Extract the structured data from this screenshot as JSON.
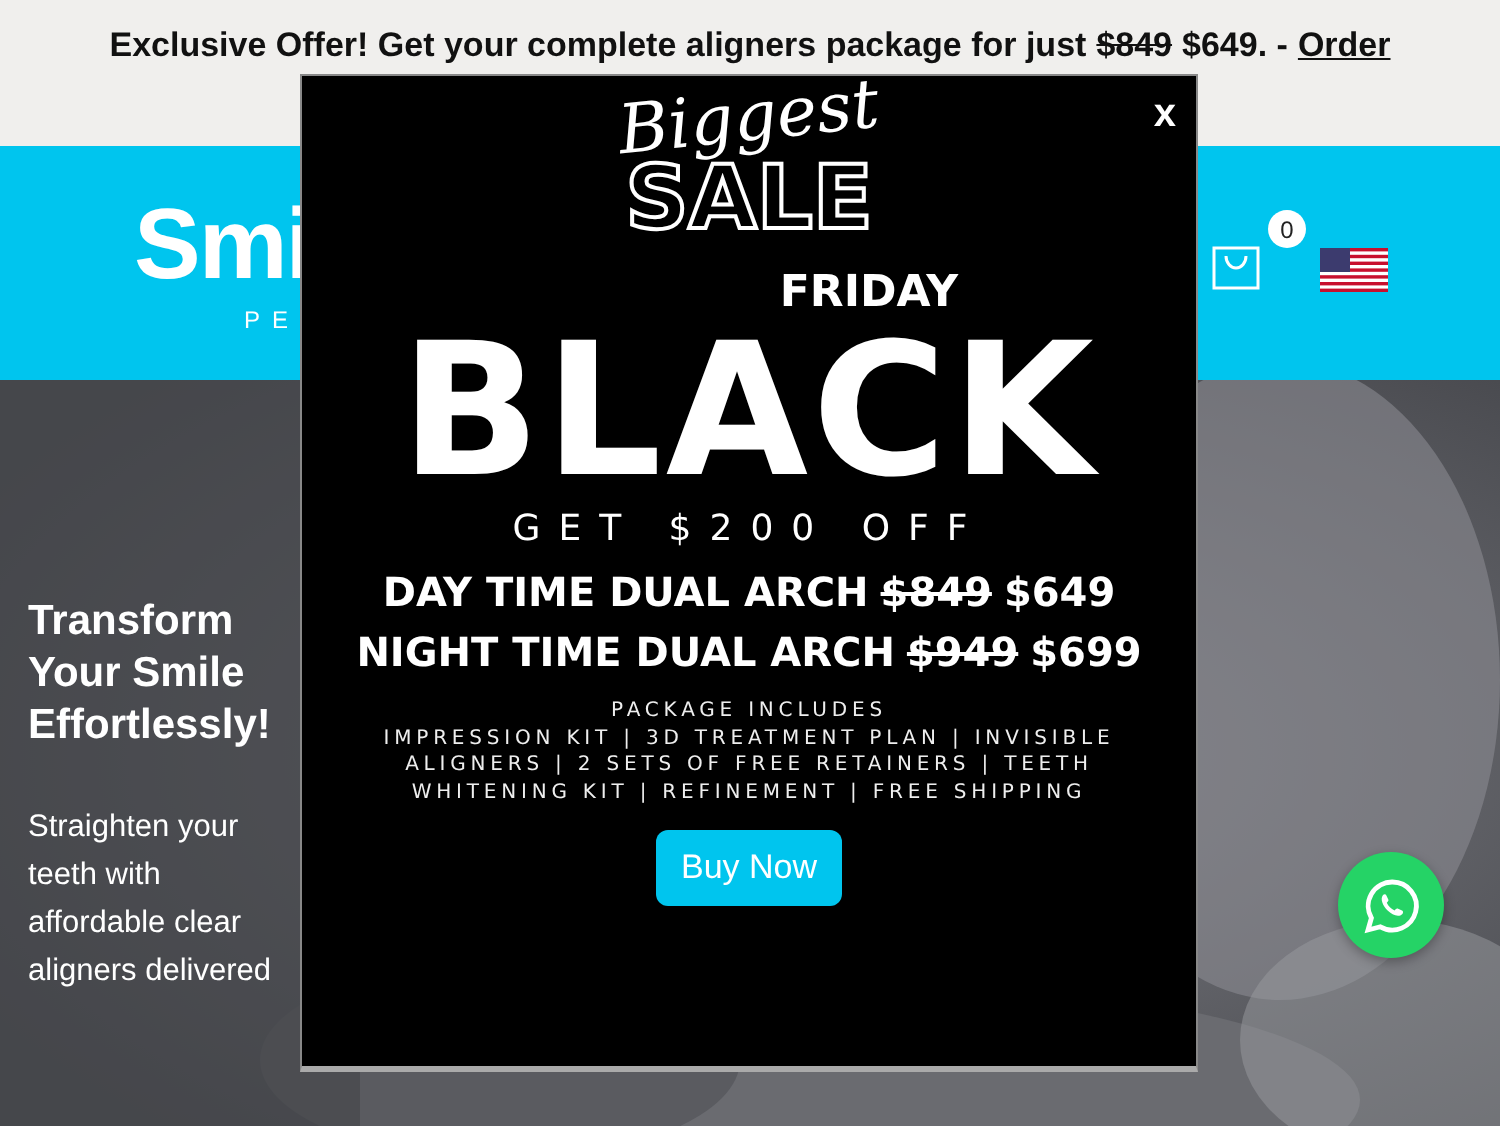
{
  "top_bar": {
    "text": "Exclusive Offer! Get your complete aligners package for just",
    "old_price": "$849",
    "new_price": "$649. -",
    "link": "Order"
  },
  "header": {
    "logo": "Smi",
    "tagline": "PE",
    "cart_count": "0"
  },
  "hero": {
    "heading": "Transform Your Smile Effortlessly!",
    "text": "Straighten your teeth with affordable clear aligners delivered"
  },
  "popup": {
    "close": "x",
    "script_title": "Biggest",
    "title": "SALE",
    "headline": "BLACK",
    "headline_overlay": "FRIDAY",
    "offer": "GET $200 OFF",
    "prices": [
      {
        "label": "DAY TIME DUAL ARCH",
        "old_price": "$849",
        "new_price": "$649"
      },
      {
        "label": "NIGHT TIME DUAL ARCH",
        "old_price": "$949",
        "new_price": "$699"
      }
    ],
    "includes_title": "PACKAGE INCLUDES",
    "includes": "IMPRESSION KIT | 3D TREATMENT PLAN | INVISIBLE ALIGNERS | 2 SETS OF FREE RETAINERS | TEETH WHITENING KIT | REFINEMENT | FREE SHIPPING",
    "button": "Buy Now"
  }
}
